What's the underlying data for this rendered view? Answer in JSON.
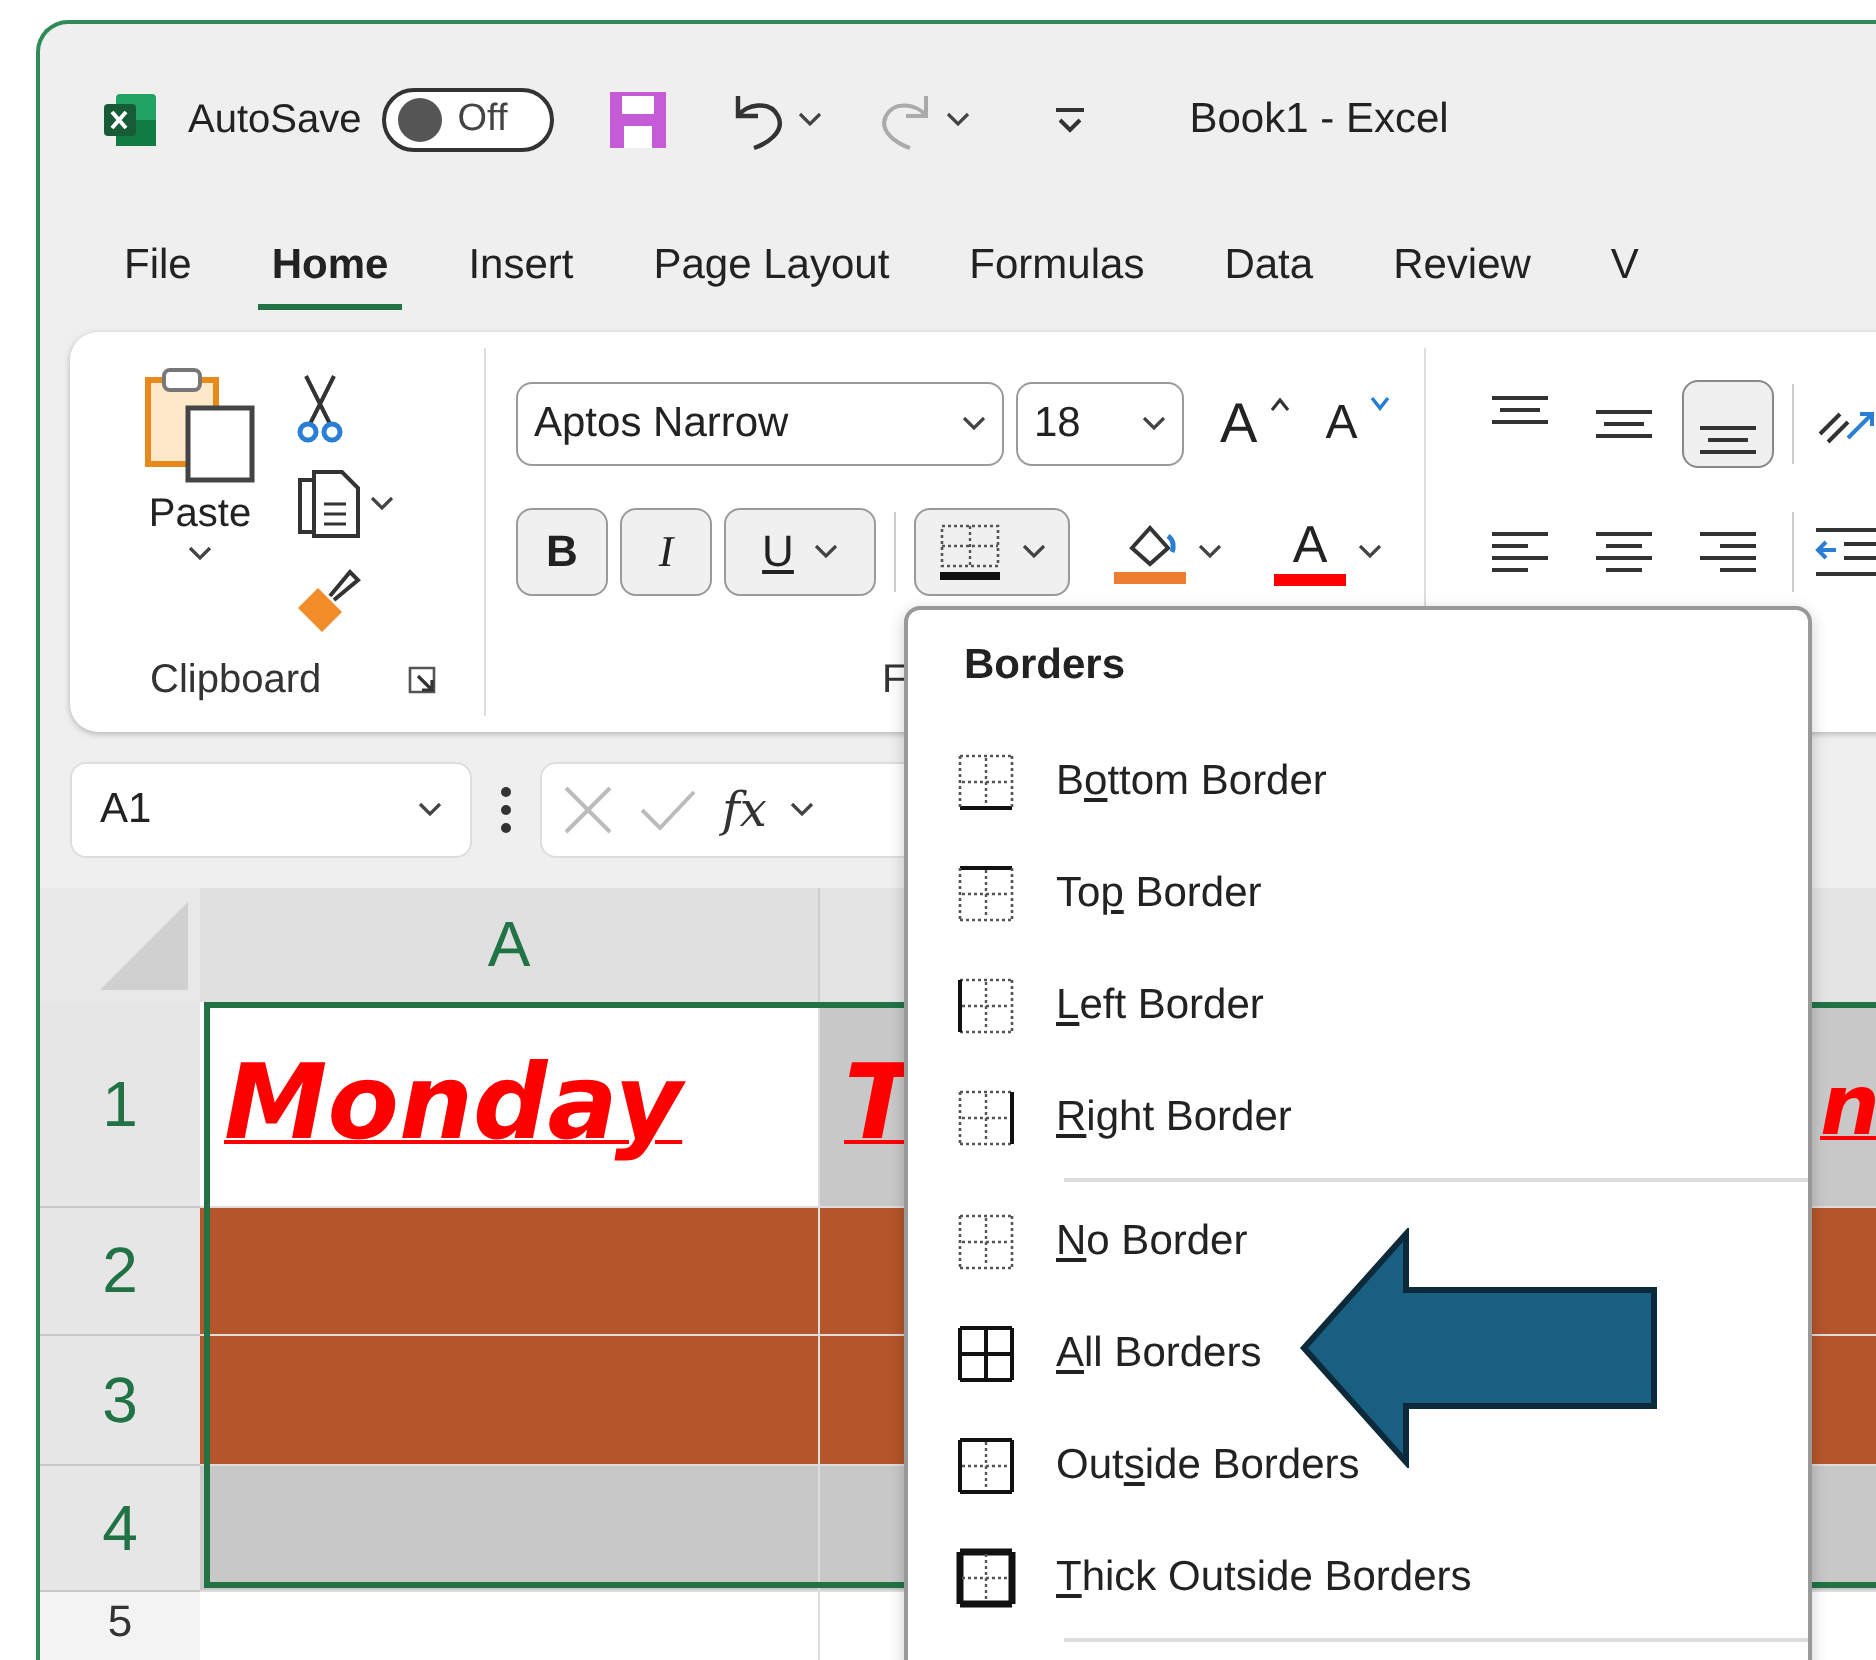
{
  "title_bar": {
    "autosave_label": "AutoSave",
    "autosave": {
      "label": "Off",
      "on": false
    },
    "title": "Book1  -  Excel"
  },
  "menu_tabs": [
    {
      "label": "File",
      "selected": false
    },
    {
      "label": "Home",
      "selected": true
    },
    {
      "label": "Insert",
      "selected": false
    },
    {
      "label": "Page Layout",
      "selected": false
    },
    {
      "label": "Formulas",
      "selected": false
    },
    {
      "label": "Data",
      "selected": false
    },
    {
      "label": "Review",
      "selected": false
    },
    {
      "label": "V",
      "selected": false
    }
  ],
  "ribbon": {
    "clipboard": {
      "paste_label": "Paste",
      "group_label": "Clipboard"
    },
    "font": {
      "font_name": "Aptos Narrow",
      "font_size": "18",
      "grow_label": "A",
      "shrink_label": "A",
      "bold_label": "B",
      "italic_label": "I",
      "underline_label": "U",
      "font_color_label": "A",
      "borders_pressed": true,
      "group_label": "F"
    },
    "alignment": {
      "vertical": [
        {
          "kind": "top",
          "selected": false
        },
        {
          "kind": "middle",
          "selected": false
        },
        {
          "kind": "bottom",
          "selected": true
        }
      ],
      "horizontal": [
        {
          "kind": "left"
        },
        {
          "kind": "center"
        },
        {
          "kind": "right"
        }
      ]
    }
  },
  "formula_bar": {
    "name_box": "A1",
    "fx_label": "fx"
  },
  "sheet": {
    "columns": [
      {
        "label": "A",
        "selected": true
      }
    ],
    "rows": [
      {
        "header": "1",
        "selected": true,
        "cells": [
          {
            "text": "Monday",
            "color": "#ffffff"
          },
          {
            "text": "T",
            "color": "#c8c8c8"
          },
          {
            "text": "n",
            "color": "#c8c8c8"
          }
        ]
      },
      {
        "header": "2",
        "selected": true,
        "cells": [
          {
            "color": "#b5562a"
          },
          {
            "color": "#b5562a"
          },
          {
            "color": "#b5562a"
          }
        ]
      },
      {
        "header": "3",
        "selected": true,
        "cells": [
          {
            "color": "#b5562a"
          },
          {
            "color": "#b5562a"
          },
          {
            "color": "#b5562a"
          }
        ]
      },
      {
        "header": "4",
        "selected": true,
        "cells": [
          {
            "color": "#c8c8c8"
          },
          {
            "color": "#c8c8c8"
          },
          {
            "color": "#c8c8c8"
          }
        ]
      },
      {
        "header": "5",
        "selected": false,
        "cells": [
          {
            "color": "#ffffff"
          },
          {
            "color": "#ffffff"
          },
          {
            "color": "#ffffff"
          }
        ]
      }
    ]
  },
  "borders_menu": {
    "title": "Borders",
    "sections": [
      [
        {
          "kind": "bottom",
          "before": "B",
          "key": "o",
          "after": "ttom Border"
        },
        {
          "kind": "top",
          "before": "To",
          "key": "p",
          "after": " Border"
        },
        {
          "kind": "left",
          "key": "L",
          "after": "eft Border"
        },
        {
          "kind": "right",
          "key": "R",
          "after": "ight Border"
        }
      ],
      [
        {
          "kind": "none",
          "key": "N",
          "after": "o Border"
        },
        {
          "kind": "all",
          "key": "A",
          "after": "ll Borders"
        },
        {
          "kind": "outside",
          "before": "Out",
          "key": "s",
          "after": "ide Borders"
        },
        {
          "kind": "thick",
          "key": "T",
          "after": "hick Outside Borders"
        }
      ]
    ]
  }
}
